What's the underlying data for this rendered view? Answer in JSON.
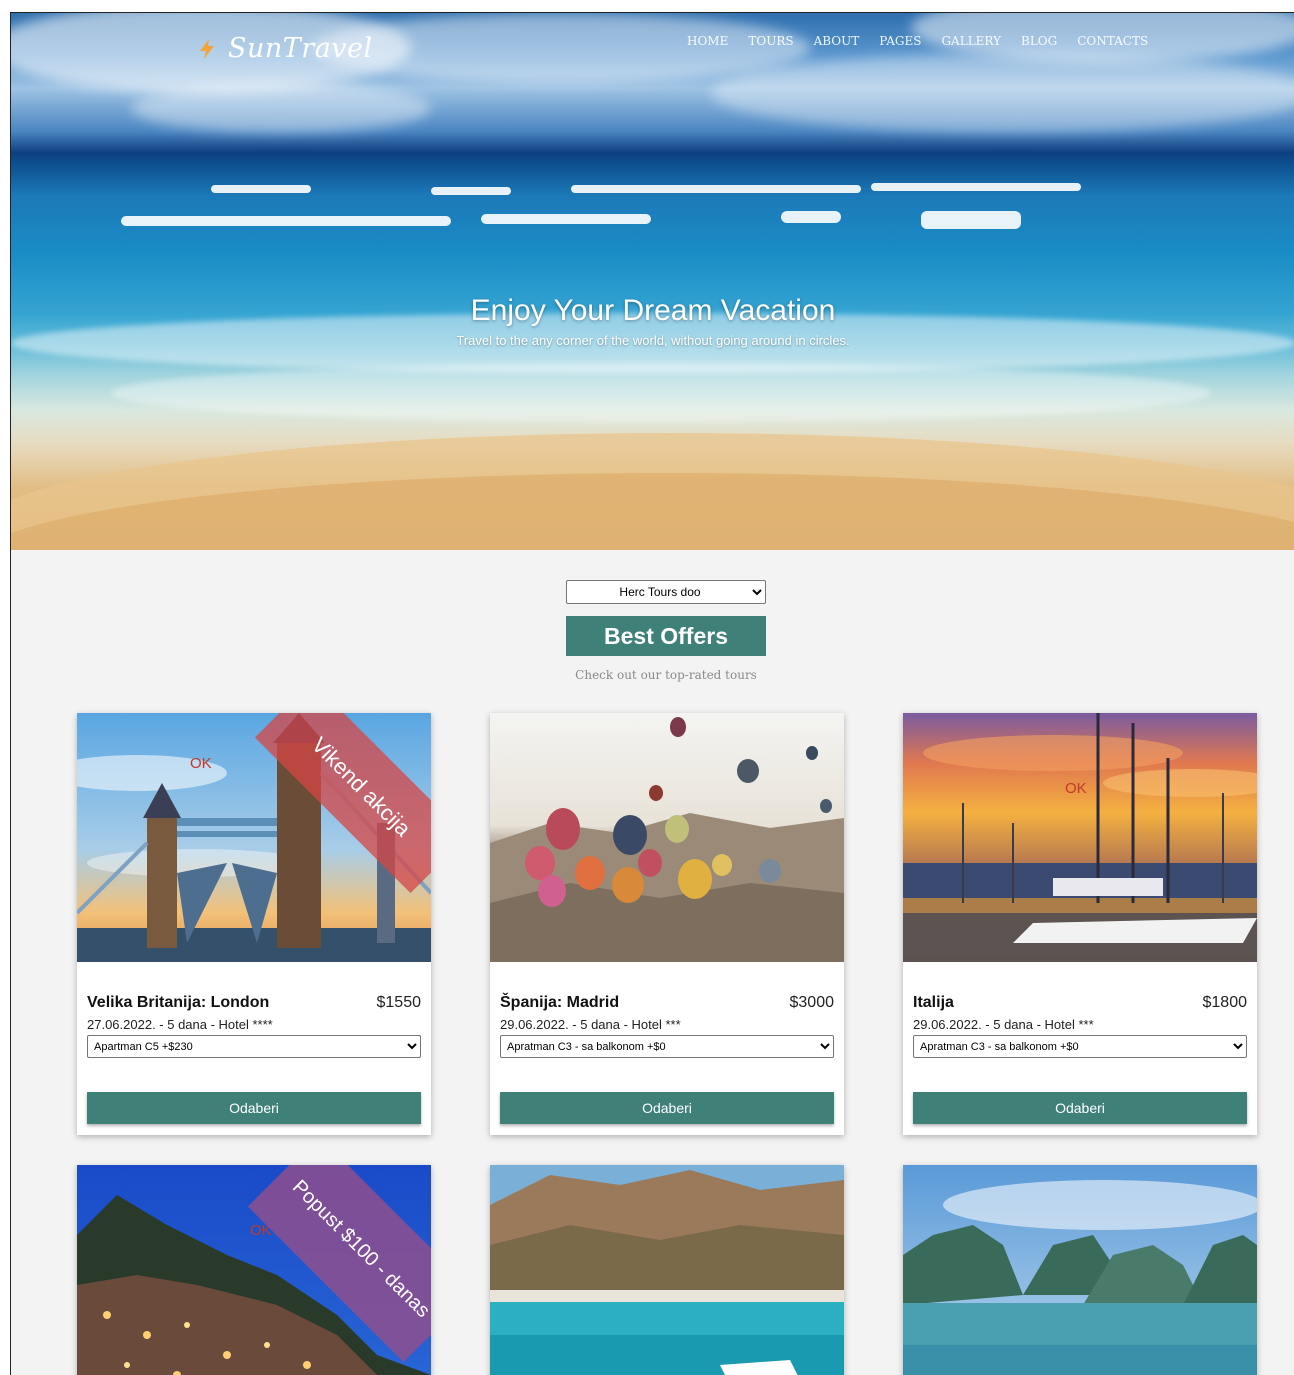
{
  "header": {
    "logo_text": "SunTravel",
    "nav": [
      "HOME",
      "TOURS",
      "ABOUT",
      "PAGES",
      "GALLERY",
      "BLOG",
      "CONTACTS"
    ]
  },
  "hero": {
    "title": "Enjoy Your Dream Vacation",
    "subtitle": "Travel to the any corner of the world, without going around in circles."
  },
  "offers": {
    "agency_select": "Herc Tours doo",
    "title": "Best Offers",
    "subtitle": "Check out our top-rated tours"
  },
  "cards": [
    {
      "title": "Velika Britanija: London",
      "price": "$1550",
      "meta": "27.06.2022. - 5 dana - Hotel ****",
      "option": "Apartman C5 +$230",
      "button": "Odaberi",
      "status": "OK",
      "ribbon": "Vikend akcija",
      "image": "tower-bridge-london"
    },
    {
      "title": "Španija: Madrid",
      "price": "$3000",
      "meta": "29.06.2022. - 5 dana - Hotel ***",
      "option": "Apratman C3 - sa balkonom +$0",
      "button": "Odaberi",
      "image": "hot-air-balloons"
    },
    {
      "title": "Italija",
      "price": "$1800",
      "meta": "29.06.2022. - 5 dana - Hotel ***",
      "option": "Apratman C3 - sa balkonom +$0",
      "button": "Odaberi",
      "status": "OK",
      "image": "sunset-marina"
    },
    {
      "status": "OK",
      "ribbon": "Popust $100 - danas",
      "image": "coastal-town-night"
    },
    {
      "image": "mountain-bay"
    },
    {
      "image": "karst-islands-bay"
    }
  ],
  "colors": {
    "accent": "#3f8078",
    "ribbon_red": "#d64545",
    "ribbon_purple": "#8e4f8e"
  }
}
